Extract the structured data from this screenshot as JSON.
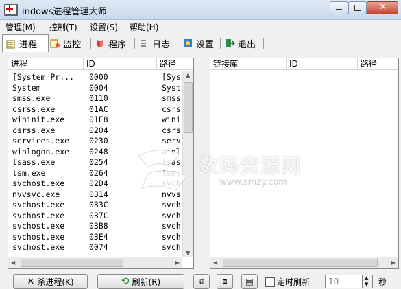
{
  "window": {
    "title": "indows进程管理大师"
  },
  "menu": [
    "管理(M)",
    "控制(T)",
    "设置(S)",
    "帮助(H)"
  ],
  "tabs": [
    {
      "label": "进程",
      "icon": "process-icon"
    },
    {
      "label": "监控",
      "icon": "monitor-icon"
    },
    {
      "label": "程序",
      "icon": "program-icon"
    },
    {
      "label": "日志",
      "icon": "log-icon"
    },
    {
      "label": "设置",
      "icon": "settings-icon"
    },
    {
      "label": "退出",
      "icon": "exit-icon"
    }
  ],
  "process_list": {
    "columns": [
      "进程",
      "ID",
      "路径"
    ],
    "rows": [
      {
        "name": "[System Pr...",
        "id": "0000",
        "path": "[Sys"
      },
      {
        "name": "System",
        "id": "0004",
        "path": "Syst"
      },
      {
        "name": "smss.exe",
        "id": "0110",
        "path": "smss"
      },
      {
        "name": "csrss.exe",
        "id": "01AC",
        "path": "csrs"
      },
      {
        "name": "wininit.exe",
        "id": "01E8",
        "path": "wini"
      },
      {
        "name": "csrss.exe",
        "id": "0204",
        "path": "csrs"
      },
      {
        "name": "services.exe",
        "id": "0230",
        "path": "serv"
      },
      {
        "name": "winlogon.exe",
        "id": "0248",
        "path": "winl"
      },
      {
        "name": "lsass.exe",
        "id": "0254",
        "path": "lsas"
      },
      {
        "name": "lsm.exe",
        "id": "0264",
        "path": "lsm."
      },
      {
        "name": "svchost.exe",
        "id": "02D4",
        "path": "svch"
      },
      {
        "name": "nvvsvc.exe",
        "id": "0314",
        "path": "nvvs"
      },
      {
        "name": "svchost.exe",
        "id": "033C",
        "path": "svch"
      },
      {
        "name": "svchost.exe",
        "id": "037C",
        "path": "svch"
      },
      {
        "name": "svchost.exe",
        "id": "03B8",
        "path": "svch"
      },
      {
        "name": "svchost.exe",
        "id": "03E4",
        "path": "svch"
      },
      {
        "name": "svchost.exe",
        "id": "0074",
        "path": "svch"
      }
    ]
  },
  "module_list": {
    "columns": [
      "链接库",
      "ID",
      "路径"
    ]
  },
  "bottom": {
    "kill_label": "杀进程(K)",
    "refresh_label": "刷新(R)",
    "timer_label": "定时刷新",
    "interval_value": "10",
    "unit": "秒"
  },
  "watermark": {
    "text": "数码资源网",
    "sub": "www.smzy.com"
  }
}
